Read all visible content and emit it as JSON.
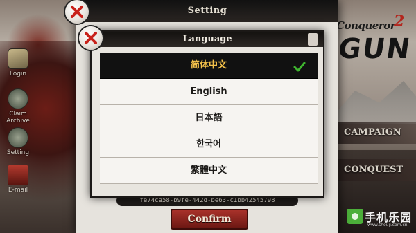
{
  "background": {
    "side_menu": [
      {
        "label": "Login",
        "icon": "login-icon"
      },
      {
        "label": "Claim Archive",
        "icon": "archive-icon"
      },
      {
        "label": "Setting",
        "icon": "setting-icon"
      },
      {
        "label": "E-mail",
        "icon": "mail-icon"
      }
    ],
    "game_title": {
      "part1": "Conqueror",
      "part2": "2",
      "part3": "GUN"
    },
    "menu_buttons": [
      "CAMPAIGN",
      "CONQUEST"
    ],
    "watermark": {
      "text": "手机乐园",
      "url": "www.shouji.com.cn"
    }
  },
  "setting_panel": {
    "title": "Setting",
    "device_id": "fe74ca58-b9fe-442d-be63-c1bb42545798",
    "confirm_label": "Confirm"
  },
  "language_dialog": {
    "title": "Language",
    "languages": [
      {
        "label": "简体中文",
        "selected": true
      },
      {
        "label": "English",
        "selected": false
      },
      {
        "label": "日本語",
        "selected": false
      },
      {
        "label": "한국어",
        "selected": false
      },
      {
        "label": "繁體中文",
        "selected": false
      }
    ]
  },
  "colors": {
    "selected_text": "#f4c14a",
    "check": "#3fb52f",
    "close_x": "#c8211a",
    "confirm_bg": "#a8322a"
  }
}
